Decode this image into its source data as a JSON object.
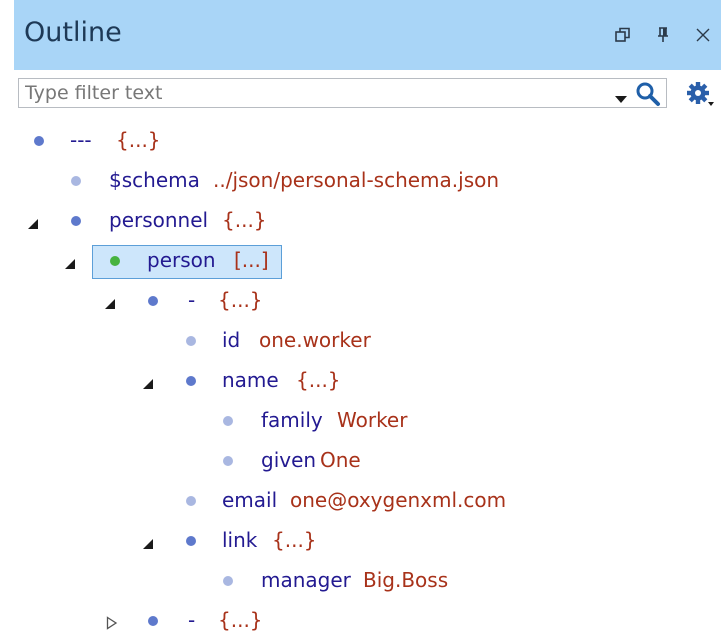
{
  "panel": {
    "title": "Outline",
    "icons": [
      "restore-icon",
      "pin-icon",
      "close-icon"
    ]
  },
  "filter": {
    "placeholder": "Type filter text",
    "value": ""
  },
  "tree": [
    {
      "key": "---",
      "value": "{...}",
      "expander": "none",
      "bullet": "dark"
    },
    {
      "key": "$schema",
      "value": "../json/personal-schema.json",
      "expander": "none",
      "bullet": "light"
    },
    {
      "key": "personnel",
      "value": "{...}",
      "expander": "expanded",
      "bullet": "dark"
    },
    {
      "key": "person",
      "value": "[...]",
      "expander": "expanded",
      "bullet": "green",
      "selected": true
    },
    {
      "key": "-",
      "value": "{...}",
      "expander": "expanded",
      "bullet": "dark"
    },
    {
      "key": "id",
      "value": "one.worker",
      "expander": "none",
      "bullet": "light"
    },
    {
      "key": "name",
      "value": "{...}",
      "expander": "expanded",
      "bullet": "dark"
    },
    {
      "key": "family",
      "value": "Worker",
      "expander": "none",
      "bullet": "light"
    },
    {
      "key": "given",
      "value": "One",
      "expander": "none",
      "bullet": "light"
    },
    {
      "key": "email",
      "value": "one@oxygenxml.com",
      "expander": "none",
      "bullet": "light"
    },
    {
      "key": "link",
      "value": "{...}",
      "expander": "expanded",
      "bullet": "dark"
    },
    {
      "key": "manager",
      "value": "Big.Boss",
      "expander": "none",
      "bullet": "light"
    },
    {
      "key": "-",
      "value": "{...}",
      "expander": "collapsed",
      "bullet": "dark"
    }
  ],
  "colors": {
    "header_bg": "#a9d5f7",
    "key": "#231a91",
    "value": "#a8321a",
    "selection_bg": "#cde6fb",
    "selection_border": "#5c9fd8"
  }
}
